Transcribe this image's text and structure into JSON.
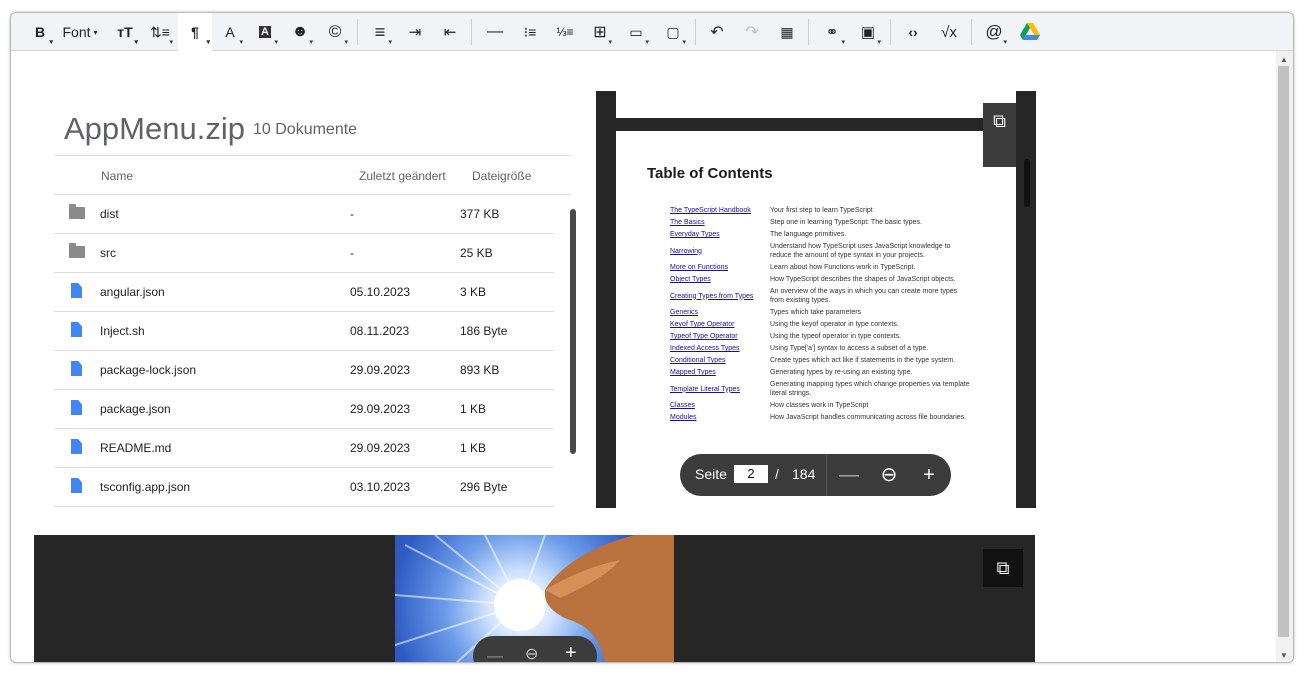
{
  "toolbar": {
    "bold": "B",
    "font": "Font",
    "items": [
      "text-size",
      "line-height",
      "paragraph",
      "font-color",
      "background-color",
      "emoji",
      "special-chars",
      "align",
      "indent",
      "outdent",
      "horizontal-rule",
      "bullet-list",
      "numbered-list",
      "table",
      "table-fill",
      "table-cell",
      "undo",
      "redo",
      "clear-format",
      "link",
      "image",
      "code",
      "formula",
      "mention",
      "google-drive"
    ]
  },
  "drive": {
    "title": "AppMenu.zip",
    "subtitle": "10 Dokumente",
    "columns": {
      "name": "Name",
      "modified": "Zuletzt geändert",
      "size": "Dateigröße"
    },
    "rows": [
      {
        "name": "dist",
        "modified": "-",
        "size": "377 KB",
        "type": "folder"
      },
      {
        "name": "src",
        "modified": "-",
        "size": "25 KB",
        "type": "folder"
      },
      {
        "name": "angular.json",
        "modified": "05.10.2023",
        "size": "3 KB",
        "type": "file"
      },
      {
        "name": "Inject.sh",
        "modified": "08.11.2023",
        "size": "186 Byte",
        "type": "file"
      },
      {
        "name": "package-lock.json",
        "modified": "29.09.2023",
        "size": "893 KB",
        "type": "file"
      },
      {
        "name": "package.json",
        "modified": "29.09.2023",
        "size": "1 KB",
        "type": "file"
      },
      {
        "name": "README.md",
        "modified": "29.09.2023",
        "size": "1 KB",
        "type": "file"
      },
      {
        "name": "tsconfig.app.json",
        "modified": "03.10.2023",
        "size": "296 Byte",
        "type": "file"
      }
    ]
  },
  "pdf": {
    "toc_title": "Table of Contents",
    "toc": [
      {
        "link": "The TypeScript Handbook",
        "desc": "Your first step to learn TypeScript"
      },
      {
        "link": "The Basics",
        "desc": "Step one in learning TypeScript: The basic types."
      },
      {
        "link": "Everyday Types",
        "desc": "The language primitives."
      },
      {
        "link": "Narrowing",
        "desc": "Understand how TypeScript uses JavaScript knowledge to reduce the amount of type syntax in your projects."
      },
      {
        "link": "More on Functions",
        "desc": "Learn about how Functions work in TypeScript."
      },
      {
        "link": "Object Types",
        "desc": "How TypeScript describes the shapes of JavaScript objects."
      },
      {
        "link": "Creating Types from Types",
        "desc": "An overview of the ways in which you can create more types from existing types."
      },
      {
        "link": "Generics",
        "desc": "Types which take parameters"
      },
      {
        "link": "Keyof Type Operator",
        "desc": "Using the keyof operator in type contexts."
      },
      {
        "link": "Typeof Type Operator",
        "desc": "Using the typeof operator in type contexts."
      },
      {
        "link": "Indexed Access Types",
        "desc": "Using Type['a'] syntax to access a subset of a type."
      },
      {
        "link": "Conditional Types",
        "desc": "Create types which act like if statements in the type system."
      },
      {
        "link": "Mapped Types",
        "desc": "Generating types by re-using an existing type."
      },
      {
        "link": "Template Literal Types",
        "desc": "Generating mapping types which change properties via template literal strings."
      },
      {
        "link": "Classes",
        "desc": "How classes work in TypeScript"
      },
      {
        "link": "Modules",
        "desc": "How JavaScript handles communicating across file boundaries."
      }
    ],
    "page_label": "Seite",
    "page": "2",
    "separator": "/",
    "total": "184"
  }
}
